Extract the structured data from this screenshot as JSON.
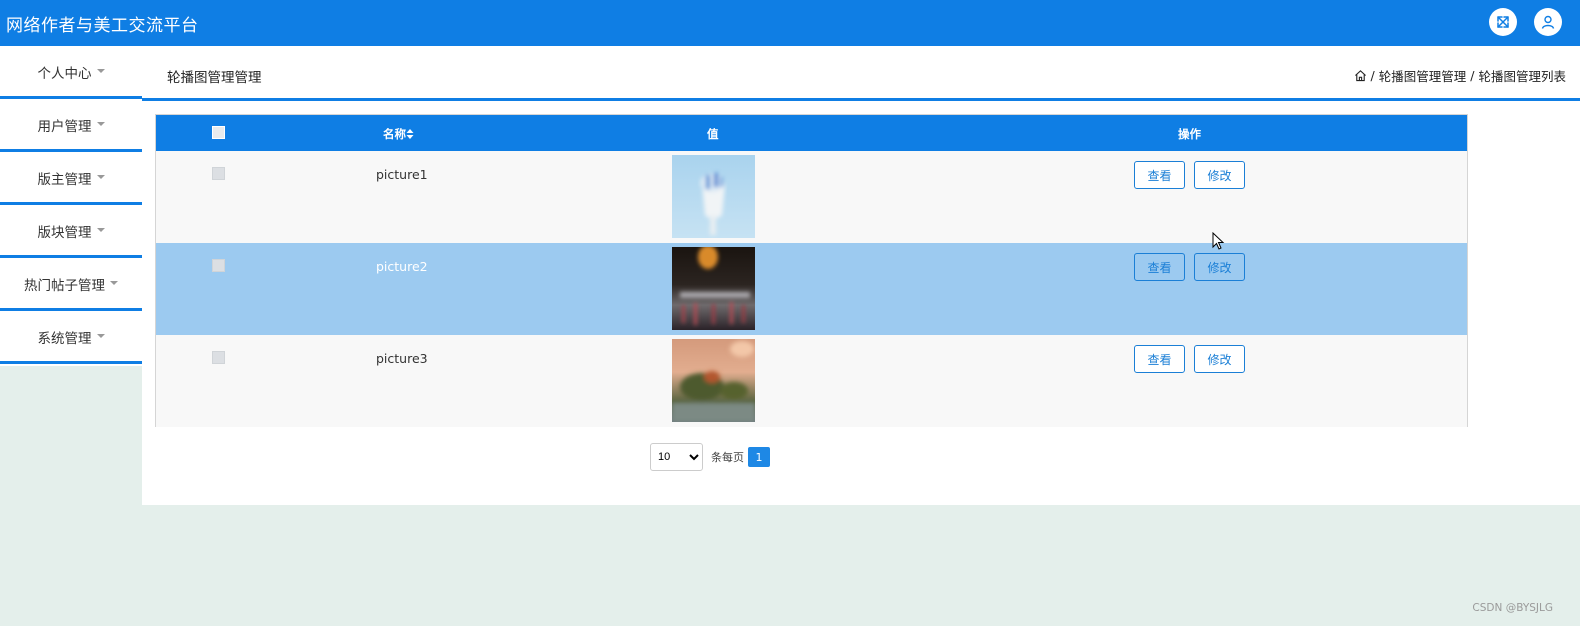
{
  "app": {
    "title": "网络作者与美工交流平台"
  },
  "header_icons": [
    "fullscreen-icon",
    "user-icon"
  ],
  "sidebar": {
    "items": [
      {
        "label": "个人中心"
      },
      {
        "label": "用户管理"
      },
      {
        "label": "版主管理"
      },
      {
        "label": "版块管理"
      },
      {
        "label": "热门帖子管理"
      },
      {
        "label": "系统管理"
      }
    ]
  },
  "page": {
    "title": "轮播图管理管理",
    "breadcrumb": {
      "sep": "/",
      "level1": "轮播图管理管理",
      "level2": "轮播图管理列表"
    }
  },
  "table": {
    "columns": {
      "name": "名称",
      "value": "值",
      "actions": "操作"
    },
    "rows": [
      {
        "name": "picture1",
        "view_label": "查看",
        "edit_label": "修改",
        "selected": false
      },
      {
        "name": "picture2",
        "view_label": "查看",
        "edit_label": "修改",
        "selected": true
      },
      {
        "name": "picture3",
        "view_label": "查看",
        "edit_label": "修改",
        "selected": false
      }
    ]
  },
  "pagination": {
    "page_size": "10",
    "page_size_options": [
      "10"
    ],
    "per_page_label": "条每页",
    "current_page": "1"
  },
  "watermark": "CSDN @BYSJLG",
  "colors": {
    "primary": "#0f7ee4",
    "selected_row": "#9ccaf0",
    "background": "#e4efeb"
  }
}
